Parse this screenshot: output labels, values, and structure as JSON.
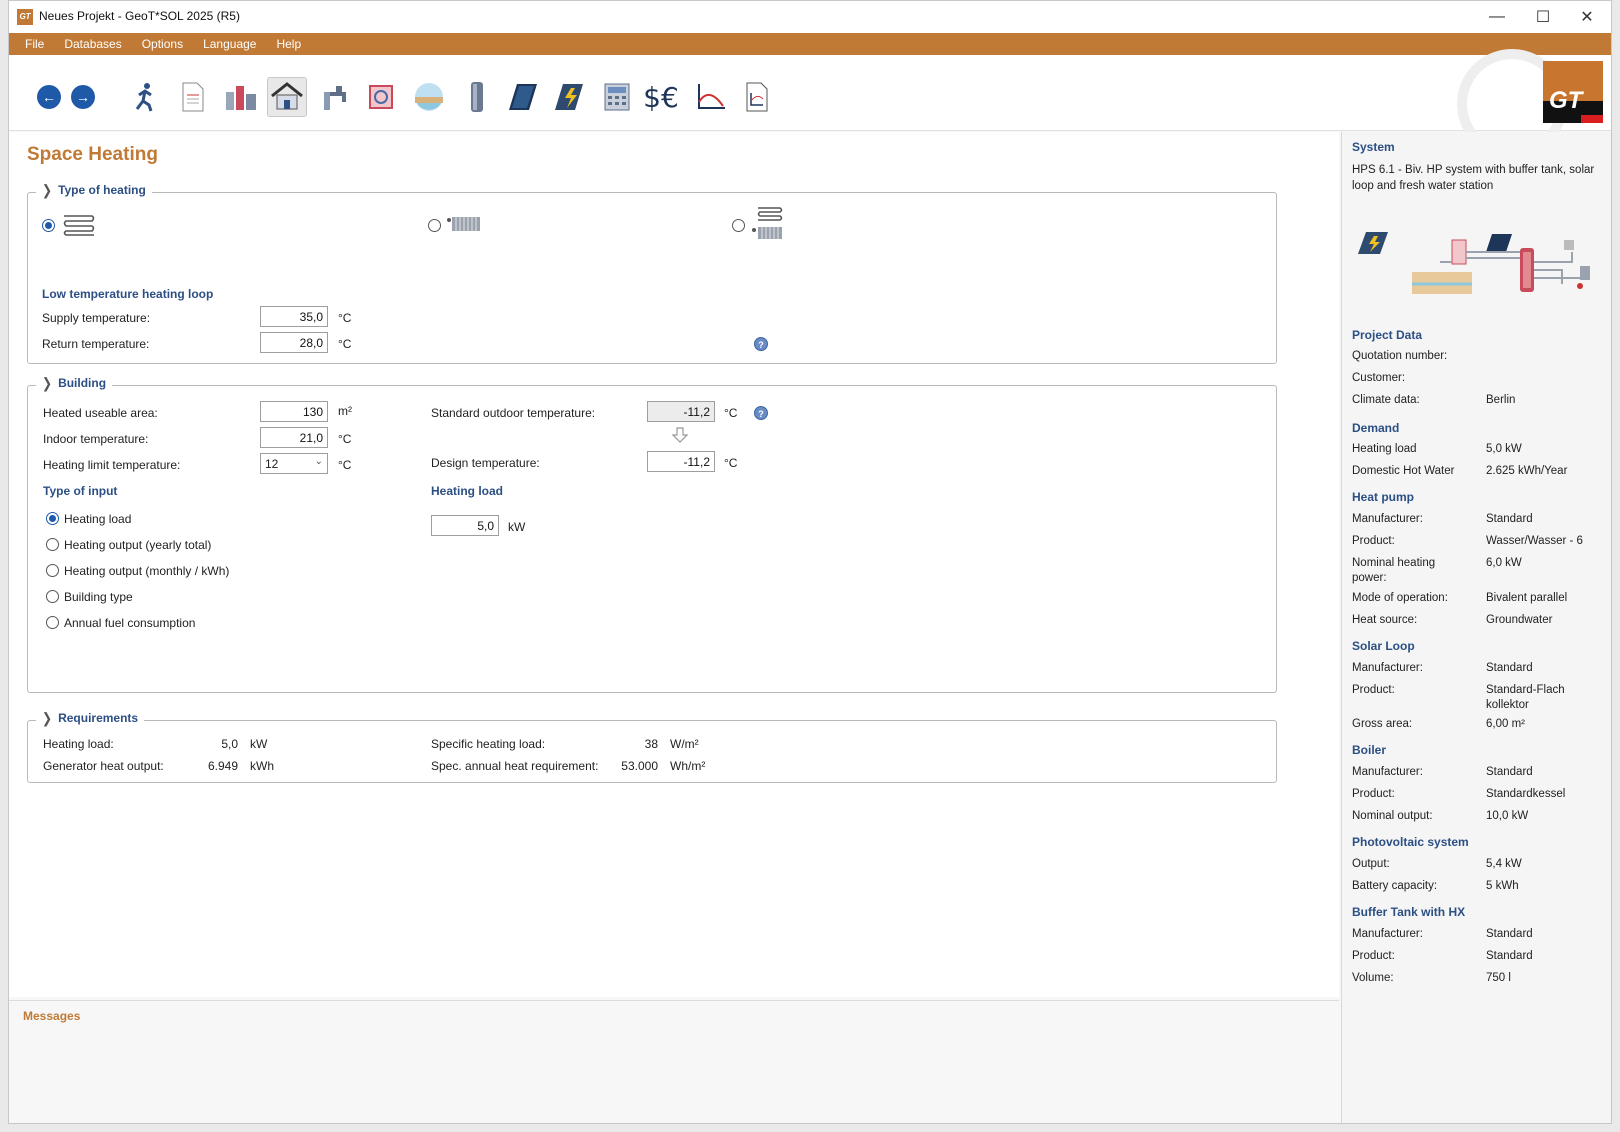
{
  "window": {
    "title": "Neues Projekt - GeoT*SOL 2025 (R5)",
    "app_icon": "GT",
    "minimize": "—",
    "maximize": "☐",
    "close": "✕"
  },
  "menu": [
    "File",
    "Databases",
    "Options",
    "Language",
    "Help"
  ],
  "logo_text": "GT",
  "page_title": "Space Heating",
  "type_of_heating": {
    "legend": "Type of heating",
    "loop_title": "Low temperature heating loop",
    "supply_label": "Supply temperature:",
    "supply_value": "35,0",
    "return_label": "Return temperature:",
    "return_value": "28,0",
    "unit_c": "°C"
  },
  "building": {
    "legend": "Building",
    "area_label": "Heated useable area:",
    "area_value": "130",
    "area_unit": "m²",
    "indoor_label": "Indoor temperature:",
    "indoor_value": "21,0",
    "limit_label": "Heating limit temperature:",
    "limit_value": "12",
    "outdoor_label": "Standard outdoor temperature:",
    "outdoor_value": "-11,2",
    "design_label": "Design temperature:",
    "design_value": "-11,2",
    "unit_c": "°C",
    "type_of_input_title": "Type of input",
    "input_options": [
      "Heating load",
      "Heating output (yearly total)",
      "Heating output (monthly / kWh)",
      "Building type",
      "Annual fuel consumption"
    ],
    "heating_load_title": "Heating load",
    "heating_load_value": "5,0",
    "heating_load_unit": "kW"
  },
  "requirements": {
    "legend": "Requirements",
    "heating_load_label": "Heating load:",
    "heating_load_value": "5,0",
    "heating_load_unit": "kW",
    "generator_label": "Generator heat output:",
    "generator_value": "6.949",
    "generator_unit": "kWh",
    "specific_label": "Specific heating load:",
    "specific_value": "38",
    "specific_unit": "W/m²",
    "annual_label": "Spec. annual heat requirement:",
    "annual_value": "53.000",
    "annual_unit": "Wh/m²"
  },
  "messages_title": "Messages",
  "side": {
    "system_h": "System",
    "system_desc": "HPS 6.1 - Biv. HP system with buffer tank, solar loop and fresh water station",
    "project_h": "Project Data",
    "quotation_k": "Quotation number:",
    "customer_k": "Customer:",
    "climate_k": "Climate data:",
    "climate_v": "Berlin",
    "demand_h": "Demand",
    "heating_load_k": "Heating load",
    "heating_load_v": "5,0 kW",
    "dhw_k": "Domestic Hot Water",
    "dhw_v": "2.625 kWh/Year",
    "heat_pump_h": "Heat pump",
    "hp_manu_k": "Manufacturer:",
    "hp_manu_v": "Standard",
    "hp_prod_k": "Product:",
    "hp_prod_v": "Wasser/Wasser - 6",
    "hp_power_k": "Nominal heating power:",
    "hp_power_v": "6,0 kW",
    "hp_mode_k": "Mode of operation:",
    "hp_mode_v": "Bivalent parallel",
    "hp_source_k": "Heat source:",
    "hp_source_v": "Groundwater",
    "solar_h": "Solar Loop",
    "sl_manu_k": "Manufacturer:",
    "sl_manu_v": "Standard",
    "sl_prod_k": "Product:",
    "sl_prod_v": "Standard-Flachkollektor",
    "sl_area_k": "Gross area:",
    "sl_area_v": "6,00 m²",
    "boiler_h": "Boiler",
    "b_manu_k": "Manufacturer:",
    "b_manu_v": "Standard",
    "b_prod_k": "Product:",
    "b_prod_v": "Standardkessel",
    "b_out_k": "Nominal output:",
    "b_out_v": "10,0 kW",
    "pv_h": "Photovoltaic system",
    "pv_out_k": "Output:",
    "pv_out_v": "5,4 kW",
    "pv_batt_k": "Battery capacity:",
    "pv_batt_v": "5 kWh",
    "buffer_h": "Buffer Tank with HX",
    "bt_manu_k": "Manufacturer:",
    "bt_manu_v": "Standard",
    "bt_prod_k": "Product:",
    "bt_prod_v": "Standard",
    "bt_vol_k": "Volume:",
    "bt_vol_v": "750 l"
  }
}
